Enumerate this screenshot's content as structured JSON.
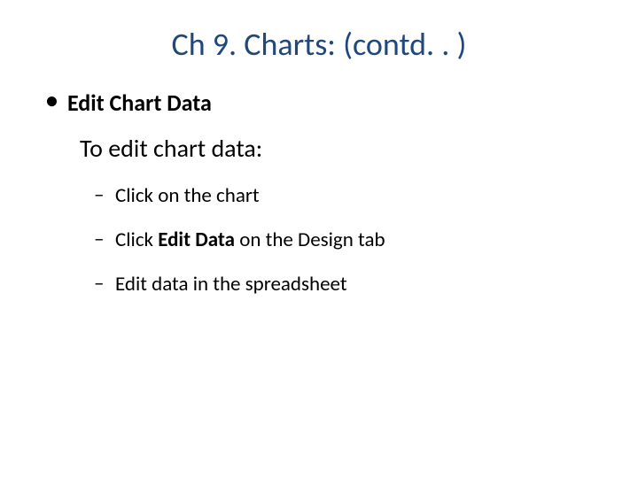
{
  "title": "Ch 9. Charts: (contd. . )",
  "section_heading": "Edit Chart Data",
  "intro_line": "To edit chart data:",
  "steps": {
    "s1": "Click on the chart",
    "s2_a": "Click ",
    "s2_b": "Edit Data",
    "s2_c": " on the Design tab",
    "s3": "Edit data in the spreadsheet"
  }
}
